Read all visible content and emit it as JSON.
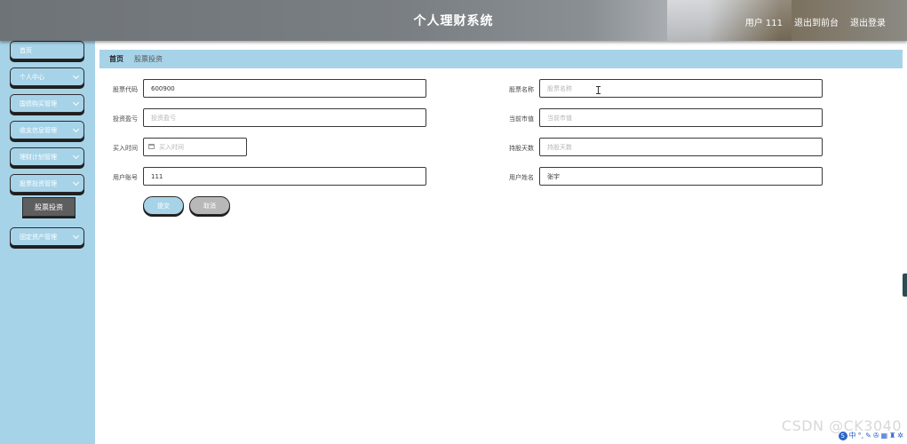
{
  "header": {
    "title": "个人理财系统",
    "user": "用户 111",
    "front": "退出到前台",
    "logout": "退出登录"
  },
  "sidebar": {
    "items": [
      {
        "label": "首页",
        "chevron": false
      },
      {
        "label": "个人中心",
        "chevron": true
      },
      {
        "label": "国债购买管理",
        "chevron": true
      },
      {
        "label": "收支信息管理",
        "chevron": true
      },
      {
        "label": "理财计划管理",
        "chevron": true
      },
      {
        "label": "股票投资管理",
        "chevron": true
      },
      {
        "label": "固定资产管理",
        "chevron": true
      }
    ],
    "sub_item": "股票投资"
  },
  "breadcrumb": {
    "home": "首页",
    "current": "股票投资"
  },
  "form": {
    "stock_code": {
      "label": "股票代码",
      "value": "600900",
      "placeholder": ""
    },
    "stock_name": {
      "label": "股票名称",
      "value": "",
      "placeholder": "股票名称"
    },
    "profit": {
      "label": "投资盈亏",
      "value": "",
      "placeholder": "投资盈亏"
    },
    "market_value": {
      "label": "当前市值",
      "value": "",
      "placeholder": "当前市值"
    },
    "buy_time": {
      "label": "买入时间",
      "value": "",
      "placeholder": "买入时间"
    },
    "hold_days": {
      "label": "持股天数",
      "value": "",
      "placeholder": "持股天数"
    },
    "account": {
      "label": "用户账号",
      "value": "111",
      "placeholder": ""
    },
    "username": {
      "label": "用户姓名",
      "value": "张宇",
      "placeholder": ""
    },
    "submit": "提交",
    "cancel": "取消"
  },
  "watermark": "CSDN @CK3040",
  "tray_icons": [
    "logo-icon",
    "chinese-icon",
    "punctuation-icon",
    "pen-icon",
    "mic-icon",
    "keyboard-icon",
    "shirt-icon",
    "settings-icon"
  ],
  "colors": {
    "accent": "#a7d3e8",
    "header": "#7a7f83",
    "sub_active": "#5e5e5e"
  }
}
